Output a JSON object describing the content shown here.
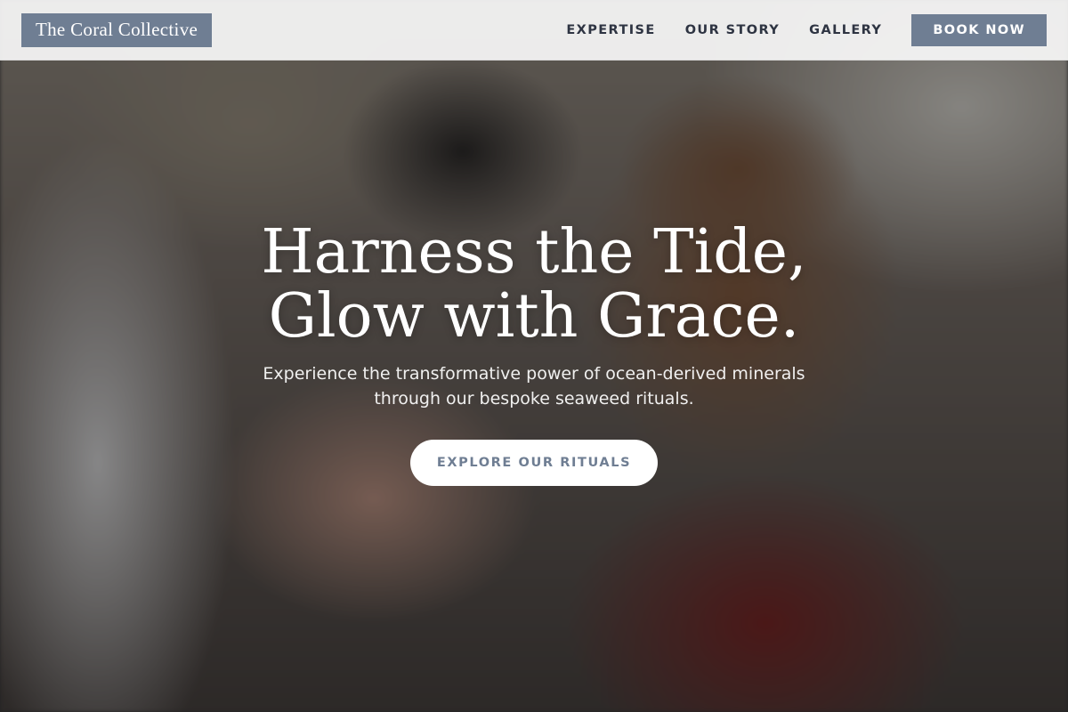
{
  "brand": {
    "name": "The Coral Collective",
    "accent": "#6f7e93"
  },
  "nav": {
    "items": [
      "EXPERTISE",
      "OUR STORY",
      "GALLERY"
    ],
    "cta": "BOOK NOW"
  },
  "hero": {
    "title_line1": "Harness the Tide,",
    "title_line2": "Glow with Grace.",
    "subtitle_line1": "Experience the transformative power of ocean-derived minerals",
    "subtitle_line2": "through our bespoke seaweed rituals.",
    "cta": "EXPLORE OUR RITUALS"
  }
}
